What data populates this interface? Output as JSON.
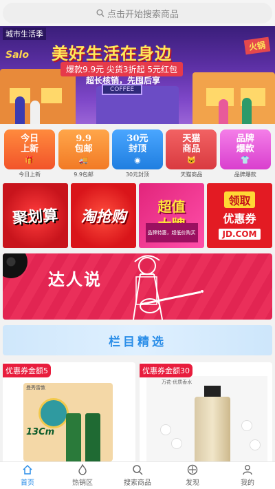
{
  "search": {
    "placeholder": "点击开始搜索商品",
    "icon": "search-icon"
  },
  "banner": {
    "city_tag": "城市生活季",
    "headline": "美好生活在身边",
    "promo_strip": "爆款9.9元  尖货3折起  5元红包",
    "subline": "超长核销，先囤后享",
    "sign_right": "火锅",
    "sign_left": "Salo",
    "coffee_sign": "COFFEE"
  },
  "categories": [
    {
      "line1": "今日",
      "line2": "上新",
      "label": "今日上新",
      "color": "#f46a2c",
      "icon": "gift-icon"
    },
    {
      "line1": "9.9",
      "line2": "包邮",
      "label": "9.9包邮",
      "color": "#f7892f",
      "icon": "truck-icon"
    },
    {
      "line1": "30元",
      "line2": "封顶",
      "label": "30元封顶",
      "color": "#2f8be8",
      "icon": "coin-icon"
    },
    {
      "line1": "天猫",
      "line2": "商品",
      "label": "天猫商品",
      "color": "#e5484d",
      "icon": "tmall-icon"
    },
    {
      "line1": "品牌",
      "line2": "爆款",
      "label": "品牌爆款",
      "color": "#e94fd6",
      "icon": "shirt-icon"
    }
  ],
  "promos": [
    {
      "name": "promo-juhuasuan",
      "text": "聚划算"
    },
    {
      "name": "promo-taoqianggou",
      "text": "淘抢购"
    },
    {
      "name": "promo-chaozhidapai",
      "line1": "超值",
      "line2": "大牌",
      "sub": "品牌特惠，超低价购买"
    },
    {
      "name": "promo-jd-coupon",
      "line1": "领取",
      "line2": "优惠券",
      "jd": "JD.COM"
    }
  ],
  "talent": {
    "title": "达人说"
  },
  "section": {
    "title": "栏目精选"
  },
  "products": [
    {
      "coupon": "优惠券金额5",
      "brand": "曼秀雷敦",
      "label": "13Cm"
    },
    {
      "coupon": "优惠券金额30",
      "brand": "万花·优质香水"
    }
  ],
  "tabbar": [
    {
      "label": "首页",
      "icon": "home-icon",
      "active": true
    },
    {
      "label": "热销区",
      "icon": "fire-icon",
      "active": false
    },
    {
      "label": "搜索商品",
      "icon": "search-icon",
      "active": false
    },
    {
      "label": "发现",
      "icon": "compass-icon",
      "active": false
    },
    {
      "label": "我的",
      "icon": "user-icon",
      "active": false
    }
  ],
  "colors": {
    "accent": "#2b8ee8",
    "coupon": "#e81d3d"
  }
}
